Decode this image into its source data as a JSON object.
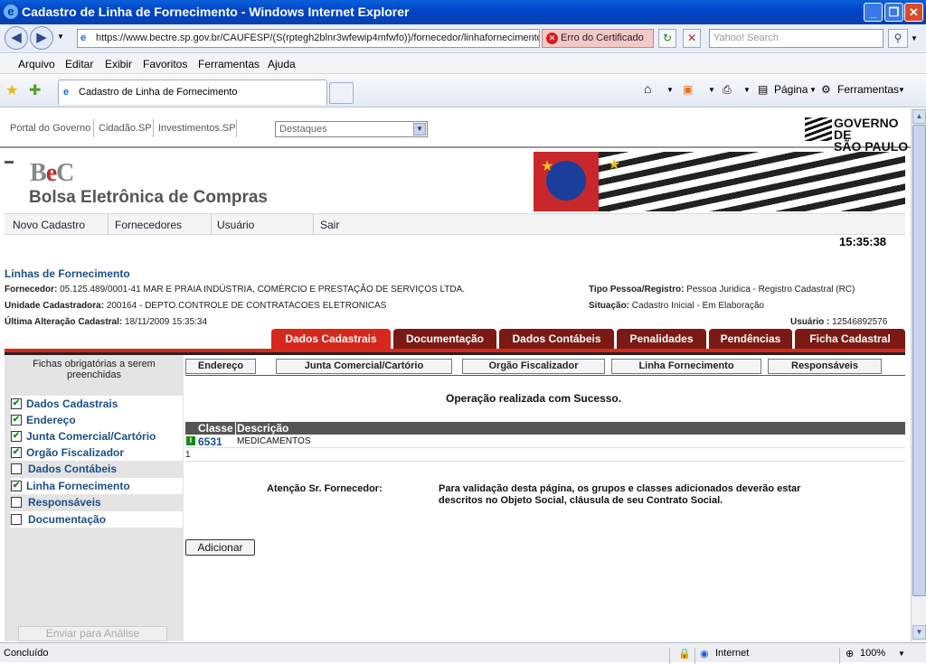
{
  "window": {
    "title": "Cadastro de Linha de Fornecimento - Windows Internet Explorer",
    "ie_glyph": "e"
  },
  "address": {
    "url": "https://www.bectre.sp.gov.br/CAUFESP/(S(rptegh2blnr3wfewip4mfwfo))/fornecedor/linhafornecimento",
    "cert_error": "Erro do Certificado",
    "search_placeholder": "Yahoo! Search"
  },
  "menu": [
    "Arquivo",
    "Editar",
    "Exibir",
    "Favoritos",
    "Ferramentas",
    "Ajuda"
  ],
  "tab": {
    "label": "Cadastro de Linha de Fornecimento"
  },
  "tools": {
    "pagina": "Página",
    "ferramentas": "Ferramentas"
  },
  "gov": {
    "links": [
      "Portal do Governo",
      "Cidadão.SP",
      "Investimentos.SP"
    ],
    "destaques": "Destaques",
    "logo1": "GOVERNO DE",
    "logo2": "SÃO PAULO"
  },
  "banner": {
    "brand_b": "B",
    "brand_e": "e",
    "brand_c": "C",
    "title": "Bolsa Eletrônica de Compras"
  },
  "topmenu": [
    "Novo Cadastro",
    "Fornecedores",
    "Usuário",
    "Sair"
  ],
  "clock": "15:35:38",
  "section_title": "Linhas de Fornecimento",
  "info": {
    "fornecedor_label": "Fornecedor:",
    "fornecedor": "05.125.489/0001-41  MAR E PRAIA INDÚSTRIA, COMÉRCIO E PRESTAÇÃO DE SERVIÇOS LTDA.",
    "unidade_label": "Unidade Cadastradora:",
    "unidade": "200164 - DEPTO.CONTROLE DE CONTRATACOES ELETRONICAS",
    "alteracao_label": "Última Alteração Cadastral:",
    "alteracao": "18/11/2009 15:35:34",
    "tipo_label": "Tipo Pessoa/Registro:",
    "tipo": "Pessoa Juridica - Registro Cadastral (RC)",
    "situacao_label": "Situação:",
    "situacao": "Cadastro Inicial - Em Elaboração",
    "usuario_label": "Usuário :",
    "usuario": "12546892576"
  },
  "tabs": [
    "Dados Cadastrais",
    "Documentação",
    "Dados Contábeis",
    "Penalidades",
    "Pendências",
    "Ficha Cadastral"
  ],
  "sidebar": {
    "header": "Fichas obrigatórias a serem preenchidas",
    "items": [
      {
        "label": "Dados Cadastrais",
        "checked": true
      },
      {
        "label": "Endereço",
        "checked": true
      },
      {
        "label": "Junta Comercial/Cartório",
        "checked": true
      },
      {
        "label": "Orgão Fiscalizador",
        "checked": true
      },
      {
        "label": "Dados Contábeis",
        "checked": false
      },
      {
        "label": "Linha Fornecimento",
        "checked": true
      },
      {
        "label": "Responsáveis",
        "checked": false
      },
      {
        "label": "Documentação",
        "checked": false
      }
    ],
    "enviar": "Enviar para Análise"
  },
  "subtabs": [
    "Endereço",
    "Junta Comercial/Cartório",
    "Orgão Fiscalizador",
    "Linha Fornecimento",
    "Responsáveis"
  ],
  "success": "Operação realizada com Sucesso.",
  "table": {
    "headers": [
      "Classe",
      "Descrição"
    ],
    "rows": [
      {
        "classe": "6531",
        "descricao": "MEDICAMENTOS"
      }
    ],
    "page": "1"
  },
  "attention": {
    "label": "Atenção Sr. Fornecedor:",
    "message": "Para validação desta página, os grupos e classes adicionados deverão estar descritos no Objeto Social, cláusula de seu Contrato Social."
  },
  "add_button": "Adicionar",
  "status": {
    "text": "Concluído",
    "zone": "Internet",
    "zoom": "100%"
  }
}
